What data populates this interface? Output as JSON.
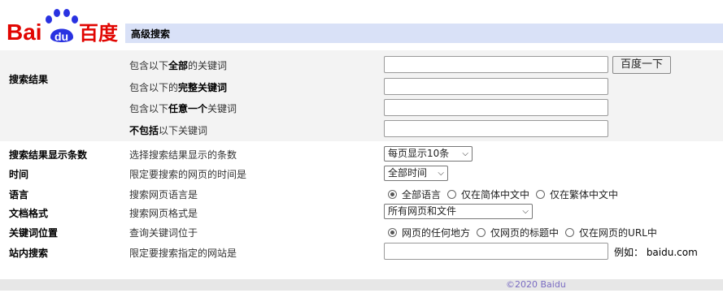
{
  "header": {
    "logo_text_left": "Bai",
    "logo_text_badge": "du",
    "logo_text_right": "百度",
    "title": "高级搜索"
  },
  "search_results": {
    "label": "搜索结果",
    "rows": [
      {
        "prefix": "包含以下",
        "bold": "全部",
        "suffix": "的关键词",
        "value": ""
      },
      {
        "prefix": "包含以下的",
        "bold": "完整关键词",
        "suffix": "",
        "value": ""
      },
      {
        "prefix": "包含以下",
        "bold": "任意一个",
        "suffix": "关键词",
        "value": ""
      },
      {
        "prefix": "",
        "bold": "不包括",
        "suffix": "以下关键词",
        "value": ""
      }
    ],
    "submit_label": "百度一下"
  },
  "options": {
    "count": {
      "label": "搜索结果显示条数",
      "desc": "选择搜索结果显示的条数",
      "selected": "每页显示10条"
    },
    "time": {
      "label": "时间",
      "desc": "限定要搜索的网页的时间是",
      "selected": "全部时间"
    },
    "language": {
      "label": "语言",
      "desc": "搜索网页语言是",
      "choices": [
        {
          "text": "全部语言",
          "checked": true
        },
        {
          "text": "仅在简体中文中",
          "checked": false
        },
        {
          "text": "仅在繁体中文中",
          "checked": false
        }
      ]
    },
    "format": {
      "label": "文档格式",
      "desc": "搜索网页格式是",
      "selected": "所有网页和文件"
    },
    "position": {
      "label": "关键词位置",
      "desc": "查询关键词位于",
      "choices": [
        {
          "text": "网页的任何地方",
          "checked": true
        },
        {
          "text": "仅网页的标题中",
          "checked": false
        },
        {
          "text": "仅在网页的URL中",
          "checked": false
        }
      ]
    },
    "site": {
      "label": "站内搜索",
      "desc": "限定要搜索指定的网站是",
      "value": "",
      "example": "例如： baidu.com"
    }
  },
  "footer": {
    "text": "©2020 Baidu"
  },
  "colors": {
    "brand_red": "#e10602",
    "brand_blue": "#2932e1",
    "title_bar": "#d9e1f7"
  }
}
